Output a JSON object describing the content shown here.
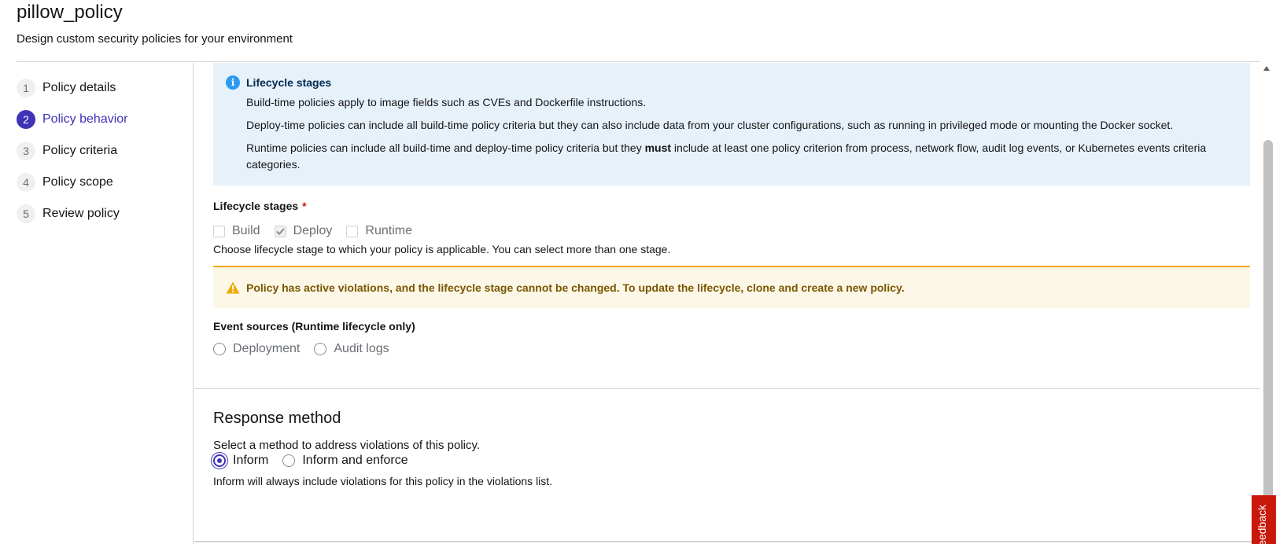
{
  "header": {
    "title": "pillow_policy",
    "subtitle": "Design custom security policies for your environment"
  },
  "wizard_steps": [
    {
      "number": "1",
      "label": "Policy details"
    },
    {
      "number": "2",
      "label": "Policy behavior"
    },
    {
      "number": "3",
      "label": "Policy criteria"
    },
    {
      "number": "4",
      "label": "Policy scope"
    },
    {
      "number": "5",
      "label": "Review policy"
    }
  ],
  "active_step": "2",
  "info_alert": {
    "icon": "info-circle-icon",
    "title": "Lifecycle stages",
    "line1": "Build-time policies apply to image fields such as CVEs and Dockerfile instructions.",
    "line2": "Deploy-time policies can include all build-time policy criteria but they can also include data from your cluster configurations, such as running in privileged mode or mounting the Docker socket.",
    "line3_before": "Runtime policies can include all build-time and deploy-time policy criteria but they ",
    "line3_bold": "must",
    "line3_after": " include at least one policy criterion from process, network flow, audit log events, or Kubernetes events criteria categories."
  },
  "lifecycle": {
    "label": "Lifecycle stages",
    "required_mark": "*",
    "options": [
      {
        "label": "Build",
        "checked": false
      },
      {
        "label": "Deploy",
        "checked": true
      },
      {
        "label": "Runtime",
        "checked": false
      }
    ],
    "helper": "Choose lifecycle stage to which your policy is applicable. You can select more than one stage."
  },
  "warning_alert": {
    "icon": "warning-triangle-icon",
    "text": "Policy has active violations, and the lifecycle stage cannot be changed. To update the lifecycle, clone and create a new policy."
  },
  "event_sources": {
    "label": "Event sources (Runtime lifecycle only)",
    "options": [
      "Deployment",
      "Audit logs"
    ]
  },
  "response_method": {
    "title": "Response method",
    "description": "Select a method to address violations of this policy.",
    "options": [
      {
        "label": "Inform",
        "selected": true
      },
      {
        "label": "Inform and enforce",
        "selected": false
      }
    ],
    "helper": "Inform will always include violations for this policy in the violations list."
  },
  "feedback": {
    "label": "Feedback"
  },
  "colors": {
    "accent": "#3e33b7",
    "info_bg": "#e7f1fa",
    "warning_bg": "#fdf7e7",
    "warning_border": "#f0ab00",
    "feedback_red": "#c9190b"
  }
}
